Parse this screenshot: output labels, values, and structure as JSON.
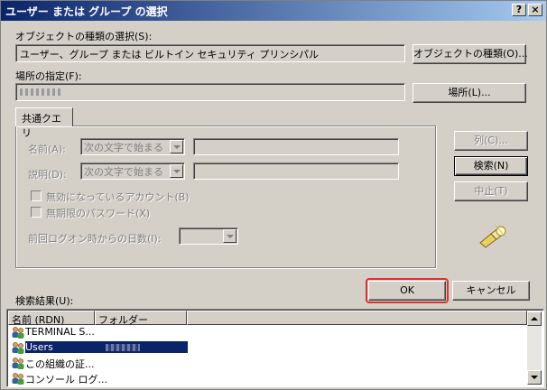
{
  "window": {
    "title": "ユーザー または グループ の選択",
    "help_label": "?",
    "close_label": "×"
  },
  "object_type": {
    "label": "オブジェクトの種類の選択(S):",
    "value": "ユーザー、グループ または ビルトイン セキュリティ プリンシパル",
    "button": "オブジェクトの種類(O)..."
  },
  "location": {
    "label": "場所の指定(F):",
    "value": "",
    "button": "場所(L)..."
  },
  "tabs": [
    {
      "label": "共通クエリ"
    }
  ],
  "query": {
    "name_label": "名前(A):",
    "name_mode": "次の文字で始まる",
    "name_value": "",
    "desc_label": "説明(D):",
    "desc_mode": "次の文字で始まる",
    "desc_value": "",
    "disabled_accounts_label": "無効になっているアカウント(B)",
    "no_expire_pw_label": "無期限のパスワード(X)",
    "days_since_logon_label": "前回ログオン時からの日数(I):",
    "days_value": ""
  },
  "side_buttons": {
    "columns": "列(C)...",
    "search": "検索(N)",
    "stop": "中止(T)"
  },
  "ok_label": "OK",
  "cancel_label": "キャンセル",
  "results": {
    "label": "検索結果(U):",
    "columns": [
      "名前 (RDN)",
      "フォルダー"
    ],
    "rows": [
      {
        "name": "TERMINAL S...",
        "folder": "",
        "selected": false
      },
      {
        "name": "Users",
        "folder": "",
        "selected": true
      },
      {
        "name": "この組織の証...",
        "folder": "",
        "selected": false
      },
      {
        "name": "コンソール ログ...",
        "folder": "",
        "selected": false
      }
    ]
  },
  "colors": {
    "face": "#d4d0c8",
    "title_start": "#0a246a",
    "title_end": "#a6caf0",
    "selection": "#0a246a",
    "highlight_box": "#e03030"
  }
}
